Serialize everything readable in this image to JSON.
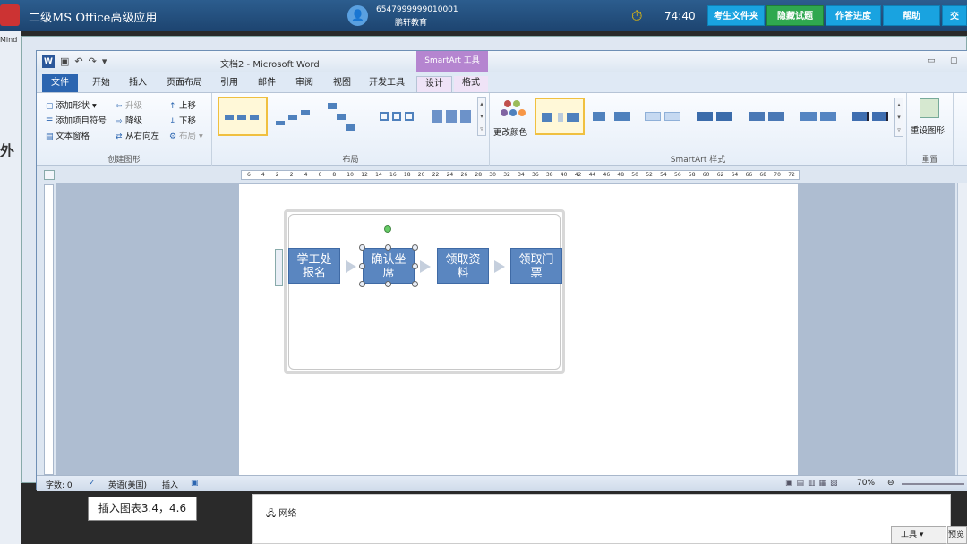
{
  "exam_bar": {
    "app_title": "二级MS Office高级应用",
    "user_id": "6547999999010001",
    "org": "鹏轩教育",
    "timer": "74:40",
    "buttons": [
      "考生文件夹",
      "隐藏试题",
      "作答进度",
      "帮助",
      "交"
    ]
  },
  "left_strip": [
    "Mind",
    "外"
  ],
  "word": {
    "doc_title": "文档2 - Microsoft Word",
    "context_tab": "SmartArt 工具",
    "tabs": [
      "文件",
      "开始",
      "插入",
      "页面布局",
      "引用",
      "邮件",
      "审阅",
      "视图",
      "开发工具",
      "设计",
      "格式"
    ],
    "active_tab": "设计",
    "groups": {
      "create": {
        "label": "创建图形",
        "items": [
          "添加形状",
          "添加项目符号",
          "文本窗格",
          "升级",
          "降级",
          "从右向左",
          "上移",
          "下移",
          "布局"
        ]
      },
      "layouts": {
        "label": "布局"
      },
      "styles": {
        "label": "SmartArt 样式",
        "change_colors": "更改颜色"
      },
      "reset": {
        "label": "重置",
        "reset_graphic": "重设图形"
      }
    },
    "ruler_ticks": [
      "6",
      "4",
      "2",
      "2",
      "4",
      "6",
      "8",
      "10",
      "12",
      "14",
      "16",
      "18",
      "20",
      "22",
      "24",
      "26",
      "28",
      "30",
      "32",
      "34",
      "36",
      "38",
      "40",
      "42",
      "44",
      "46",
      "48",
      "50",
      "52",
      "54",
      "56",
      "58",
      "60",
      "62",
      "64",
      "66",
      "68",
      "70",
      "72"
    ],
    "smartart_nodes": [
      {
        "line1": "学工处",
        "line2": "报名"
      },
      {
        "line1": "确认坐",
        "line2": "席"
      },
      {
        "line1": "领取资",
        "line2": "料"
      },
      {
        "line1": "领取门",
        "line2": "票"
      }
    ],
    "status": {
      "words": "字数: 0",
      "language": "英语(美国)",
      "mode": "插入",
      "zoom": "70%"
    }
  },
  "tooltip": "插入图表3.4，4.6",
  "bottom_panel": {
    "network": "网络",
    "tools": "工具",
    "preview": "预览"
  },
  "colors": {
    "node_fill": "#5a86c0",
    "context_tab": "#b585d0",
    "file_tab": "#2b65b0"
  }
}
